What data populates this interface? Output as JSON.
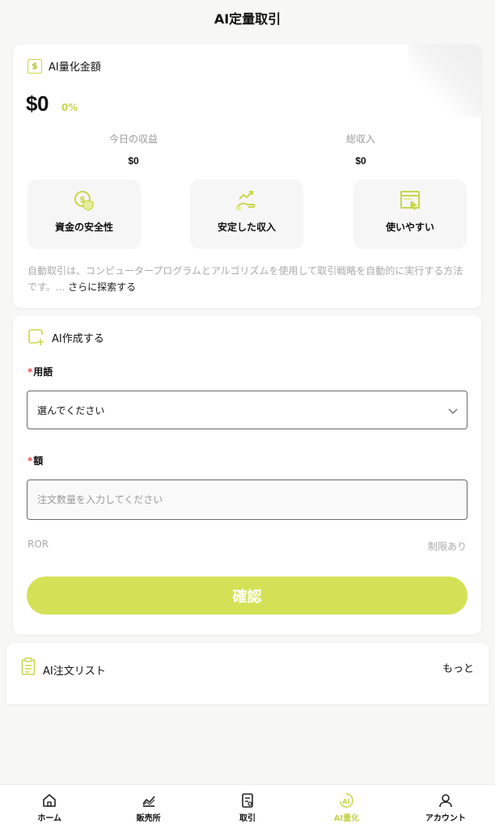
{
  "header": {
    "title": "AI定量取引"
  },
  "summary": {
    "section_label": "AI量化金額",
    "amount": "$0",
    "percent": "0%",
    "today_label": "今日の収益",
    "today_value": "$0",
    "total_label": "総収入",
    "total_value": "$0",
    "features": [
      {
        "label": "資金の安全性",
        "icon": "coin-shield-icon"
      },
      {
        "label": "安定した収入",
        "icon": "hand-chart-icon"
      },
      {
        "label": "使いやすい",
        "icon": "screen-cursor-icon"
      }
    ],
    "description": "自動取引は、コンピュータープログラムとアルゴリズムを使用して取引戦略を自動的に実行する方法です。...",
    "explore_more": "さらに探索する"
  },
  "create": {
    "section_label": "AI作成する",
    "term_label": "用語",
    "term_required": "*",
    "term_value": "選んでください",
    "amount_label": "額",
    "amount_required": "*",
    "amount_placeholder": "注文数量を入力してください",
    "ror_label": "ROR",
    "limit_label": "制限あり",
    "confirm_label": "確認"
  },
  "orders": {
    "title": "AI注文リスト",
    "more": "もっと"
  },
  "tabs": [
    {
      "label": "ホーム",
      "icon": "home-icon"
    },
    {
      "label": "販売所",
      "icon": "chart-icon"
    },
    {
      "label": "取引",
      "icon": "document-icon"
    },
    {
      "label": "AI量化",
      "icon": "ai-icon",
      "active": true
    },
    {
      "label": "アカウント",
      "icon": "user-icon"
    }
  ],
  "colors": {
    "accent": "#d4e157",
    "accent_text": "#c9d64a",
    "required": "#e04848"
  }
}
